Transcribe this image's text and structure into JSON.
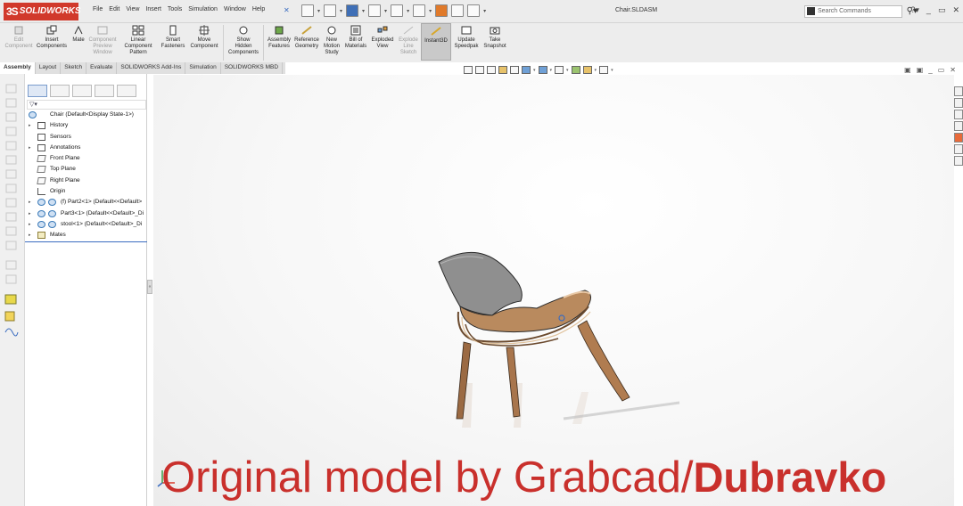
{
  "app": {
    "logo_text": "SOLIDWORKS",
    "document_title": "Chair.SLDASM"
  },
  "menu": [
    "File",
    "Edit",
    "View",
    "Insert",
    "Tools",
    "Simulation",
    "Window",
    "Help"
  ],
  "search": {
    "placeholder": "Search Commands"
  },
  "command_manager": [
    {
      "label": "Edit Component",
      "enabled": false
    },
    {
      "label": "Insert Components",
      "enabled": true
    },
    {
      "label": "Mate",
      "enabled": true
    },
    {
      "label": "Component Preview Window",
      "enabled": false
    },
    {
      "label": "Linear Component Pattern",
      "enabled": true
    },
    {
      "label": "Smart Fasteners",
      "enabled": true
    },
    {
      "label": "Move Component",
      "enabled": true
    },
    {
      "label": "Show Hidden Components",
      "enabled": true
    },
    {
      "label": "Assembly Features",
      "enabled": true
    },
    {
      "label": "Reference Geometry",
      "enabled": true
    },
    {
      "label": "New Motion Study",
      "enabled": true
    },
    {
      "label": "Bill of Materials",
      "enabled": true
    },
    {
      "label": "Exploded View",
      "enabled": true
    },
    {
      "label": "Explode Line Sketch",
      "enabled": false
    },
    {
      "label": "Instant3D",
      "enabled": true,
      "active": true
    },
    {
      "label": "Update Speedpak",
      "enabled": true
    },
    {
      "label": "Take Snapshot",
      "enabled": true
    }
  ],
  "tabs": [
    "Assembly",
    "Layout",
    "Sketch",
    "Evaluate",
    "SOLIDWORKS Add-Ins",
    "Simulation",
    "SOLIDWORKS MBD"
  ],
  "active_tab": "Assembly",
  "tree": {
    "root": "Chair  (Default<Display State-1>)",
    "items": [
      {
        "label": "History",
        "expandable": true,
        "icon": "history-icon"
      },
      {
        "label": "Sensors",
        "expandable": false,
        "icon": "sensors-icon"
      },
      {
        "label": "Annotations",
        "expandable": true,
        "icon": "annotations-icon"
      },
      {
        "label": "Front Plane",
        "expandable": false,
        "icon": "plane-icon"
      },
      {
        "label": "Top Plane",
        "expandable": false,
        "icon": "plane-icon"
      },
      {
        "label": "Right Plane",
        "expandable": false,
        "icon": "plane-icon"
      },
      {
        "label": "Origin",
        "expandable": false,
        "icon": "origin-icon"
      },
      {
        "label": "(f) Part2<1> (Default<<Default>",
        "expandable": true,
        "icon": "part-icon"
      },
      {
        "label": "Part3<1> (Default<<Default>_Di",
        "expandable": true,
        "icon": "part-icon"
      },
      {
        "label": "stool<1> (Default<<Default>_Di",
        "expandable": true,
        "icon": "part-icon"
      },
      {
        "label": "Mates",
        "expandable": true,
        "icon": "mates-icon"
      }
    ]
  },
  "caption": {
    "thin": "Original model by Grabcad/",
    "bold": "Dubravko"
  },
  "colors": {
    "brand": "#d1392b",
    "caption": "#c9302c",
    "chair_wood": "#a8754c",
    "chair_shell": "#8f8f8f"
  }
}
